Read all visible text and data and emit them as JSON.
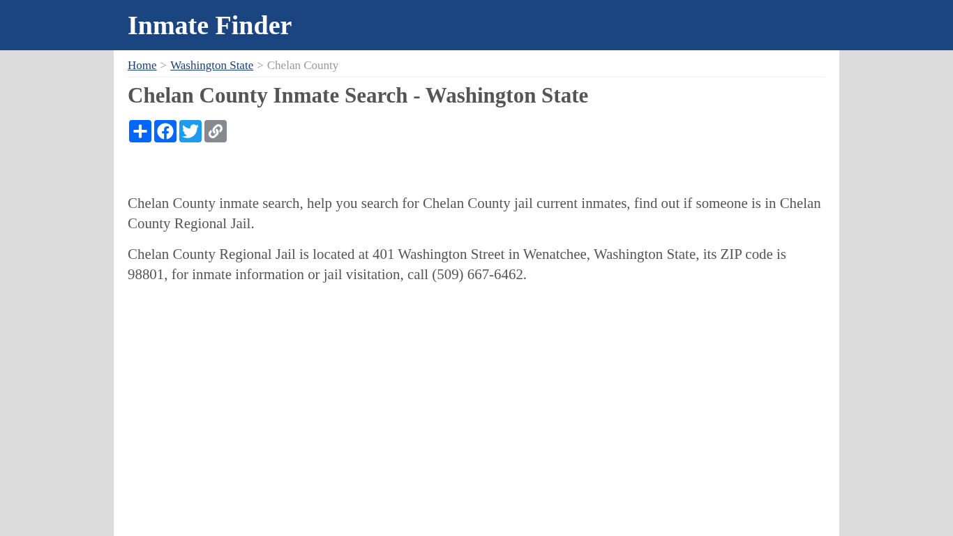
{
  "header": {
    "title": "Inmate Finder"
  },
  "breadcrumb": [
    {
      "kind": "link",
      "label": "Home"
    },
    {
      "kind": "separator",
      "label": ">"
    },
    {
      "kind": "link",
      "label": "Washington State"
    },
    {
      "kind": "separator",
      "label": ">"
    },
    {
      "kind": "current",
      "label": "Chelan County"
    }
  ],
  "page_title": "Chelan County Inmate Search - Washington State",
  "share_buttons": [
    {
      "kind": "share",
      "color": "#0166ff"
    },
    {
      "kind": "facebook",
      "color": "#0866ff"
    },
    {
      "kind": "twitter",
      "color": "#1d9bf0"
    },
    {
      "kind": "copy_link",
      "color": "#888990"
    }
  ],
  "paragraphs": [
    "Chelan County inmate search, help you search for Chelan County jail current inmates, find out if someone is in Chelan County Regional Jail.",
    "Chelan County Regional Jail is located at 401 Washington Street in Wenatchee, Washington State, its ZIP code is 98801, for inmate information or jail visitation, call (509) 667-6462."
  ]
}
